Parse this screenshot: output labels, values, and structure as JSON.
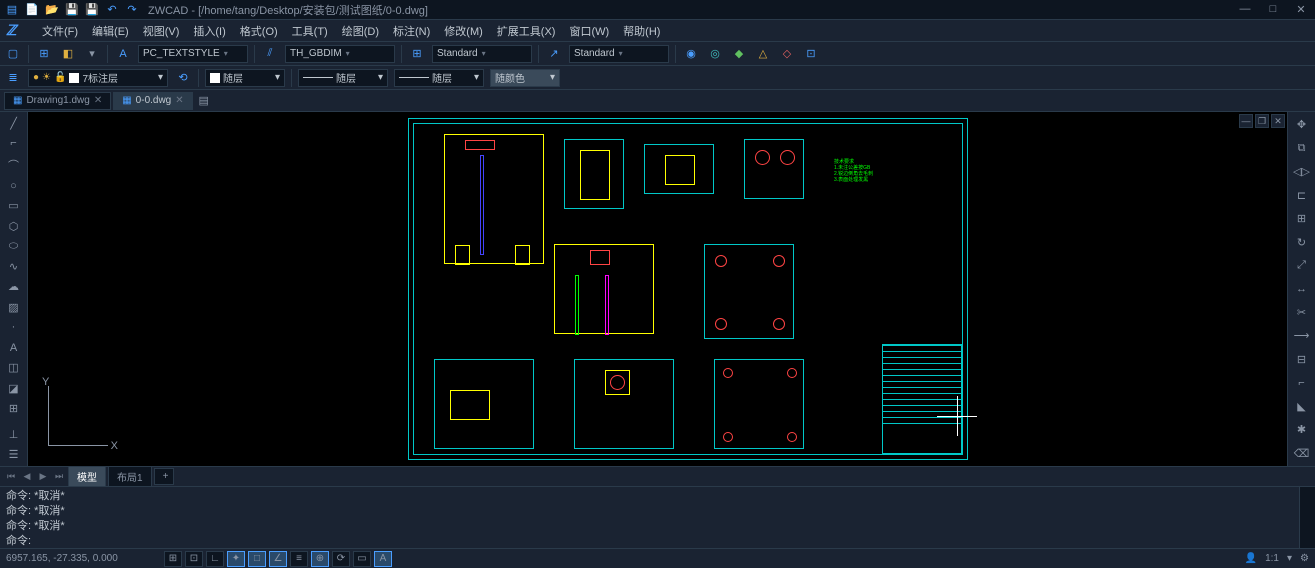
{
  "app": {
    "name": "ZWCAD",
    "title": "ZWCAD - [/home/tang/Desktop/安装包/测试图纸/0-0.dwg]"
  },
  "menubar": {
    "items": [
      "文件(F)",
      "编辑(E)",
      "视图(V)",
      "插入(I)",
      "格式(O)",
      "工具(T)",
      "绘图(D)",
      "标注(N)",
      "修改(M)",
      "扩展工具(X)",
      "窗口(W)",
      "帮助(H)"
    ]
  },
  "toolbar": {
    "textstyle": "PC_TEXTSTYLE",
    "dimstyle": "TH_GBDIM",
    "tablestyle": "Standard",
    "multileader": "Standard"
  },
  "layer": {
    "current": "7标注层",
    "linetype1": "随层",
    "linetype2": "随层",
    "linetype3": "随层",
    "color": "随颜色"
  },
  "tabs": {
    "items": [
      {
        "label": "Drawing1.dwg",
        "active": false
      },
      {
        "label": "0-0.dwg",
        "active": true
      }
    ]
  },
  "layout_tabs": {
    "items": [
      "模型",
      "布局1"
    ],
    "active": 0,
    "add": "+"
  },
  "command": {
    "history": [
      "命令: *取消*",
      "命令: *取消*",
      "命令: *取消*"
    ],
    "prompt": "命令:"
  },
  "status": {
    "coords": "6957.165, -27.335, 0.000",
    "zoom": "1:1"
  },
  "ucs": {
    "x": "X",
    "y": "Y"
  }
}
